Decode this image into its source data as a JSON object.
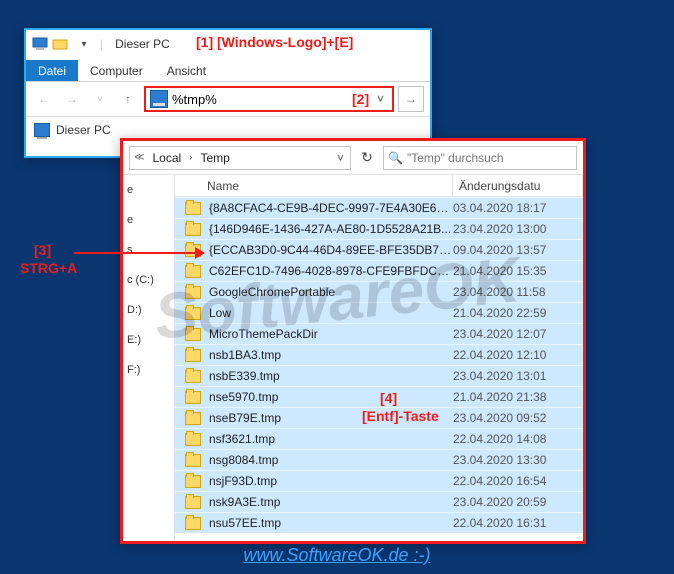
{
  "bg_window": {
    "title": "Dieser PC",
    "tabs": {
      "file": "Datei",
      "computer": "Computer",
      "view": "Ansicht"
    },
    "address_value": "%tmp%",
    "quick_label": "Dieser PC"
  },
  "fg_window": {
    "crumbs": [
      "Local",
      "Temp"
    ],
    "search_placeholder": "\"Temp\" durchsuch",
    "columns": {
      "name": "Name",
      "modified": "Änderungsdatu"
    },
    "sidebar_fragments": [
      "e",
      "e",
      "s",
      "c (C:)",
      "D:)",
      "E:)",
      "F:)"
    ],
    "files": [
      {
        "name": "{8A8CFAC4-CE9B-4DEC-9997-7E4A30E6E...",
        "date": "03.04.2020 18:17"
      },
      {
        "name": "{146D946E-1436-427A-AE80-1D5528A21B...",
        "date": "23.04.2020 13:00"
      },
      {
        "name": "{ECCAB3D0-9C44-46D4-89EE-BFE35DB7D...",
        "date": "09.04.2020 13:57"
      },
      {
        "name": "C62EFC1D-7496-4028-8978-CFE9FBFDCD...",
        "date": "21.04.2020 15:35"
      },
      {
        "name": "GoogleChromePortable",
        "date": "23.04.2020 11:58"
      },
      {
        "name": "Low",
        "date": "21.04.2020 22:59"
      },
      {
        "name": "MicroThemePackDir",
        "date": "23.04.2020 12:07"
      },
      {
        "name": "nsb1BA3.tmp",
        "date": "22.04.2020 12:10"
      },
      {
        "name": "nsbE339.tmp",
        "date": "23.04.2020 13:01"
      },
      {
        "name": "nse5970.tmp",
        "date": "21.04.2020 21:38"
      },
      {
        "name": "nseB79E.tmp",
        "date": "23.04.2020 09:52"
      },
      {
        "name": "nsf3621.tmp",
        "date": "22.04.2020 14:08"
      },
      {
        "name": "nsg8084.tmp",
        "date": "23.04.2020 13:30"
      },
      {
        "name": "nsjF93D.tmp",
        "date": "22.04.2020 16:54"
      },
      {
        "name": "nsk9A3E.tmp",
        "date": "23.04.2020 20:59"
      },
      {
        "name": "nsu57EE.tmp",
        "date": "22.04.2020 16:31"
      }
    ]
  },
  "annotations": {
    "a1": "[1]  [Windows-Logo]+[E]",
    "a2": "[2]",
    "a3_num": "[3]",
    "a3_txt": "STRG+A",
    "a4_num": "[4]",
    "a4_txt": "[Entf]-Taste"
  },
  "footer": "www.SoftwareOK.de :-)",
  "watermark": "SoftwareOK"
}
